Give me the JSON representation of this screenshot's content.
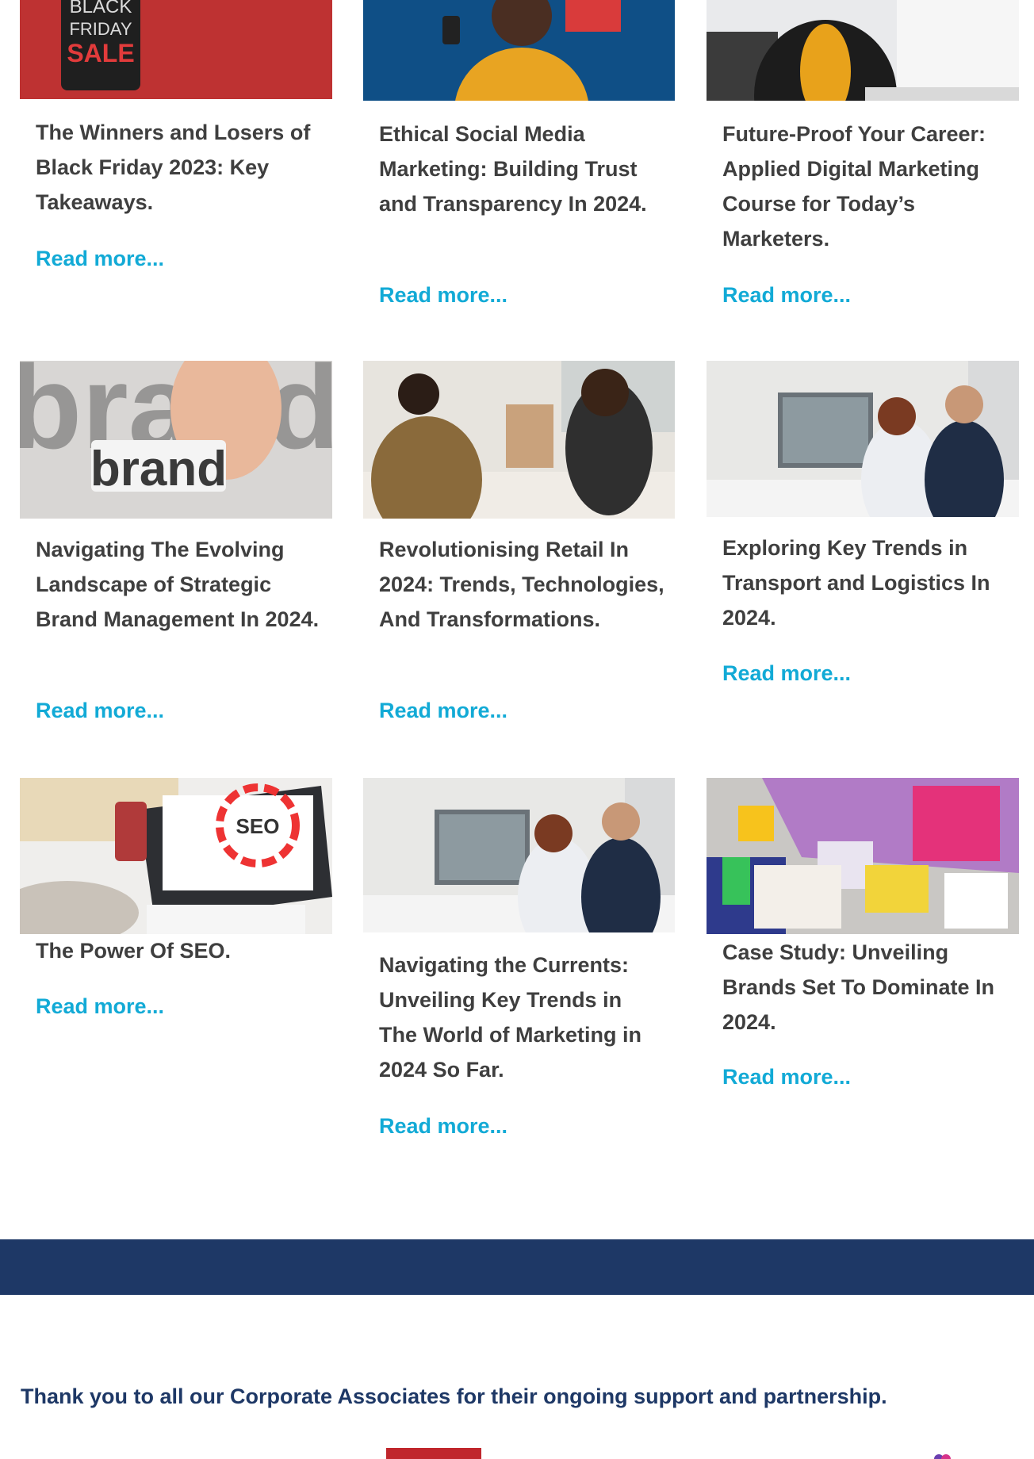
{
  "colors": {
    "title": "#3f3f3f",
    "link": "#12aad6",
    "band": "#1e3866",
    "accent_red": "#c0262c"
  },
  "articles": [
    {
      "title": "The Winners and Losers of Black Friday 2023: Key Takeaways.",
      "link": "Read more...",
      "image": "black-friday-sign",
      "image_text": [
        "BLACK",
        "FRIDAY",
        "SALE"
      ]
    },
    {
      "title": "Ethical Social Media Marketing: Building Trust and Transparency In 2024.",
      "link": "Read more...",
      "image": "woman-shopping-phone"
    },
    {
      "title": "Future-Proof Your Career: Applied Digital Marketing Course for Today’s Marketers.",
      "link": "Read more...",
      "image": "woman-at-computer"
    },
    {
      "title": "Navigating The Evolving Landscape of Strategic Brand Management In 2024.",
      "link": "Read more...",
      "image": "brand-hand",
      "image_text": [
        "brand"
      ]
    },
    {
      "title": "Revolutionising Retail In 2024: Trends, Technologies, And Transformations.",
      "link": "Read more...",
      "image": "retail-checkout"
    },
    {
      "title": "Exploring Key Trends in Transport and Logistics In 2024.",
      "link": "Read more...",
      "image": "office-monitor"
    },
    {
      "title": "The Power Of SEO.",
      "link": "Read more...",
      "image": "seo-laptop",
      "image_text": [
        "SEO"
      ]
    },
    {
      "title": "Navigating the Currents: Unveiling Key Trends in The World of Marketing in 2024 So Far.",
      "link": "Read more...",
      "image": "office-monitor"
    },
    {
      "title": "Case Study: Unveiling Brands Set To Dominate In 2024.",
      "link": "Read more...",
      "image": "moodboard-desk"
    }
  ],
  "footer": {
    "thanks": "Thank you to all our Corporate Associates for their ongoing support and partnership."
  }
}
